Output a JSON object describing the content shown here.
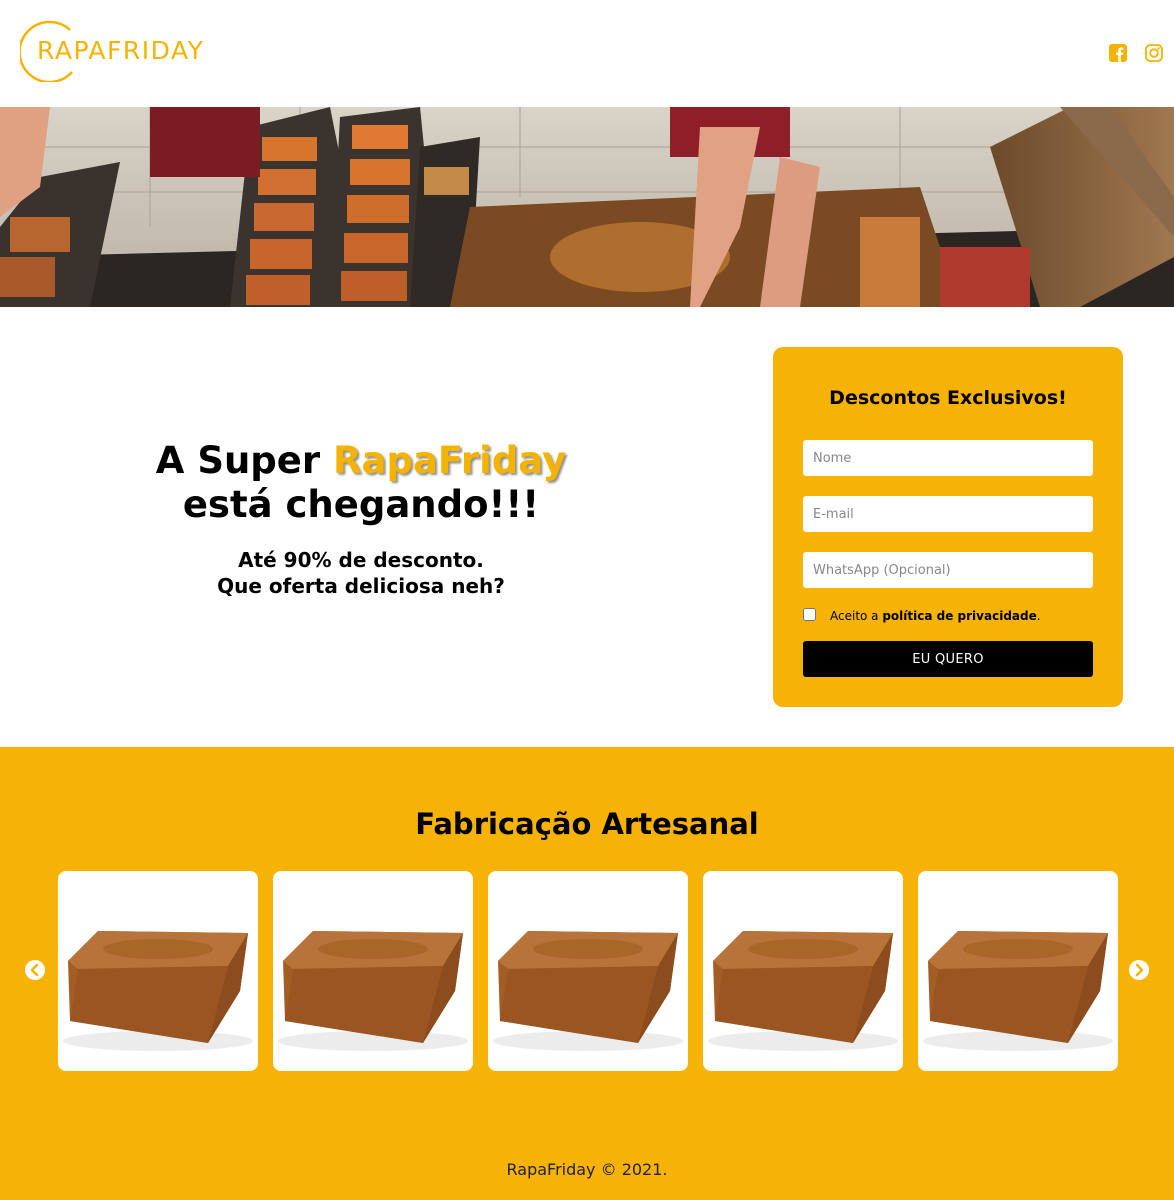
{
  "header": {
    "logo_text": "RAPAFRIDAY",
    "social": [
      {
        "name": "facebook",
        "icon": "facebook-icon"
      },
      {
        "name": "instagram",
        "icon": "instagram-icon"
      }
    ]
  },
  "promo": {
    "headline_prefix": "A Super ",
    "headline_brand": "RapaFriday",
    "headline_suffix": "está chegando!!!",
    "subline_1": "Até 90% de desconto.",
    "subline_2": "Que oferta deliciosa neh?"
  },
  "form": {
    "title": "Descontos Exclusivos!",
    "name_placeholder": "Nome",
    "email_placeholder": "E-mail",
    "whatsapp_placeholder": "WhatsApp (Opcional)",
    "consent_prefix": "Aceito a ",
    "consent_link": "política de privacidade",
    "consent_suffix": ".",
    "submit_label": "EU QUERO"
  },
  "gallery": {
    "title": "Fabricação Artesanal",
    "item_count": 5
  },
  "footer": {
    "text": "RapaFriday © 2021."
  },
  "colors": {
    "accent": "#f5b301",
    "section_background": "#f7b305",
    "button": "#000000"
  }
}
